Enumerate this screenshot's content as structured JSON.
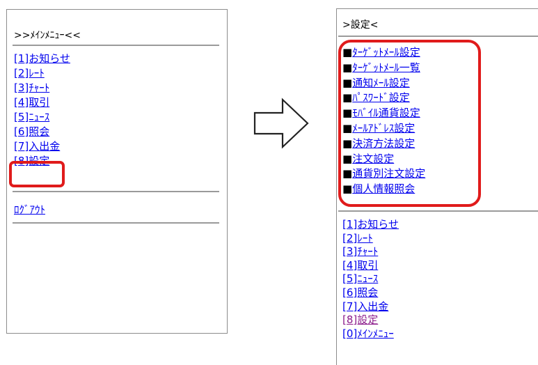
{
  "left": {
    "title": ">>ﾒｲﾝﾒﾆｭｰ<<",
    "menu": [
      {
        "label": "[1]お知らせ"
      },
      {
        "label": "[2]ﾚｰﾄ"
      },
      {
        "label": "[3]ﾁｬｰﾄ"
      },
      {
        "label": "[4]取引"
      },
      {
        "label": "[5]ﾆｭｰｽ"
      },
      {
        "label": "[6]照会"
      },
      {
        "label": "[7]入出金"
      },
      {
        "label": "[8]設定"
      }
    ],
    "logout": "ﾛｸﾞｱｳﾄ"
  },
  "right": {
    "title": ">設定<",
    "bullet": "■",
    "settings": [
      {
        "label": "ﾀｰｹﾞｯﾄﾒｰﾙ設定"
      },
      {
        "label": "ﾀｰｹﾞｯﾄﾒｰﾙ一覧"
      },
      {
        "label": "通知ﾒｰﾙ設定"
      },
      {
        "label": "ﾊﾟｽﾜｰﾄﾞ設定"
      },
      {
        "label": "ﾓﾊﾞｲﾙ通貨設定"
      },
      {
        "label": "ﾒｰﾙｱﾄﾞﾚｽ設定"
      },
      {
        "label": "決済方法設定"
      },
      {
        "label": "注文設定"
      },
      {
        "label": "通貨別注文設定"
      },
      {
        "label": "個人情報照会"
      }
    ],
    "menu": [
      {
        "label": "[1]お知らせ"
      },
      {
        "label": "[2]ﾚｰﾄ"
      },
      {
        "label": "[3]ﾁｬｰﾄ"
      },
      {
        "label": "[4]取引"
      },
      {
        "label": "[5]ﾆｭｰｽ"
      },
      {
        "label": "[6]照会"
      },
      {
        "label": "[7]入出金"
      },
      {
        "label": "[8]設定"
      },
      {
        "label": "[0]ﾒｲﾝﾒﾆｭｰ"
      }
    ]
  },
  "colors": {
    "link": "#0000ee",
    "visited": "#8b1a8b",
    "highlight": "#e01b1b"
  },
  "icons": {
    "arrow": "right-arrow-icon"
  }
}
